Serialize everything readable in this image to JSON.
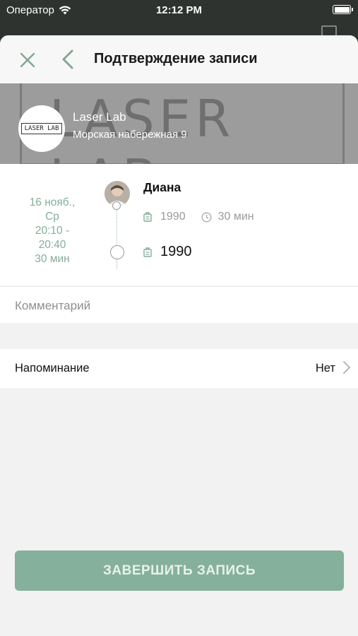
{
  "status_bar": {
    "carrier": "Оператор",
    "time": "12:12 PM"
  },
  "navbar": {
    "title": "Подтверждение записи"
  },
  "shop": {
    "name": "Laser Lab",
    "address": "Морская набережная 9",
    "logo_text": "LASER LAB",
    "banner_text": "LASER LAB"
  },
  "appointment": {
    "date_line1": "16 нояб.,",
    "date_line2": "Ср",
    "time_line1": "20:10 -",
    "time_line2": "20:40",
    "duration": "30 мин",
    "master_name": "Диана",
    "service_price": "1990",
    "service_duration": "30 мин",
    "total_price": "1990"
  },
  "comment": {
    "placeholder": "Комментарий"
  },
  "reminder": {
    "label": "Напоминание",
    "value": "Нет"
  },
  "finish_button": {
    "label": "ЗАВЕРШИТЬ ЗАПИСЬ"
  },
  "colors": {
    "accent": "#85b09c",
    "date_text": "#86ae9a",
    "banner": "#9c9c9c"
  }
}
